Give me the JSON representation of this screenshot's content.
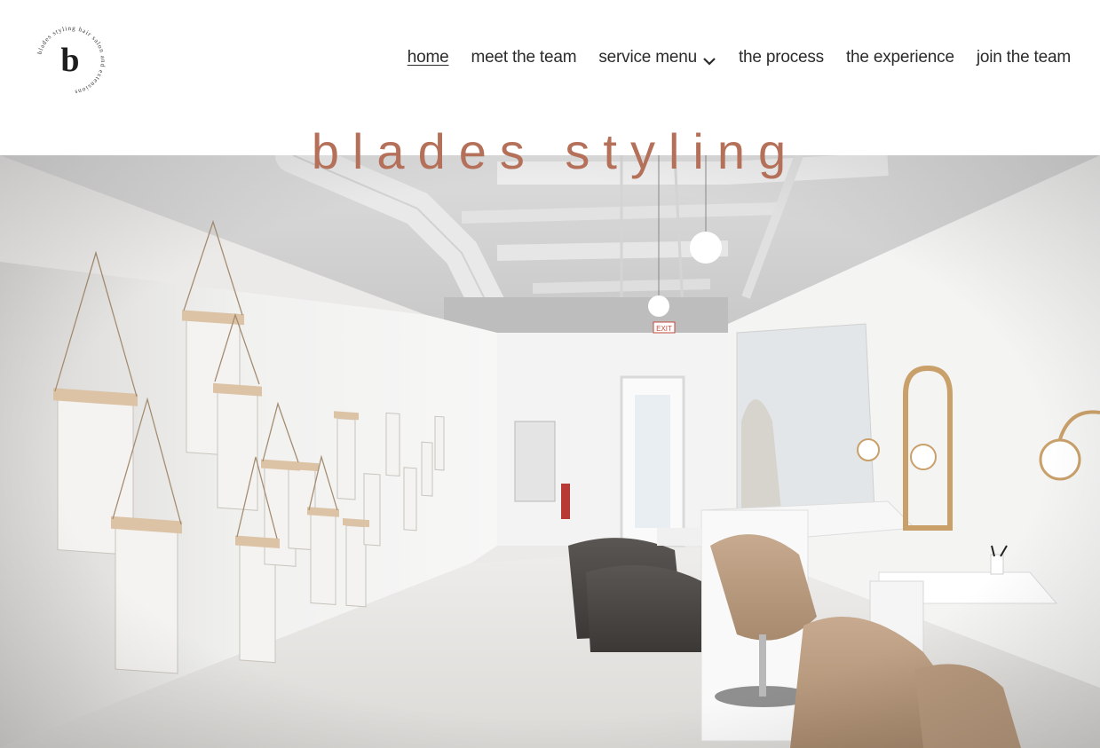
{
  "brand": {
    "logo_letter": "b",
    "logo_ring_text": "blades styling hair salon and extensions",
    "site_title": "blades styling"
  },
  "nav": {
    "items": [
      {
        "label": "home",
        "active": true
      },
      {
        "label": "meet the team"
      },
      {
        "label": "service menu",
        "has_dropdown": true
      },
      {
        "label": "the process"
      },
      {
        "label": "the experience"
      },
      {
        "label": "join the team"
      }
    ]
  },
  "hero": {
    "image": "salon interior photo",
    "exit_sign": "EXIT"
  },
  "colors": {
    "title": "#b5705a",
    "nav_text": "#2b2b2b",
    "background": "#ffffff"
  },
  "icons": {
    "dropdown": "chevron-down-icon"
  }
}
